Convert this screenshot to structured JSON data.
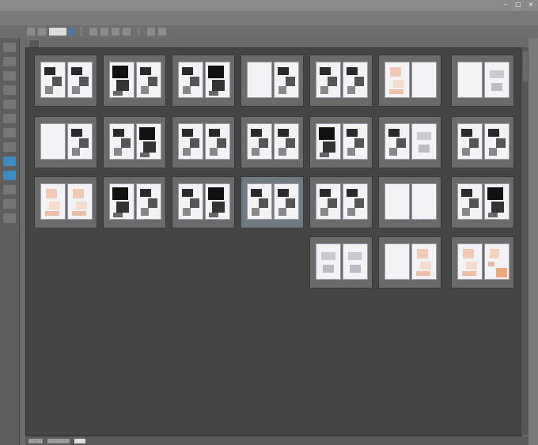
{
  "window": {
    "menu_items": [
      "",
      "",
      "",
      "",
      "",
      "",
      "",
      "",
      "",
      "",
      ""
    ],
    "controls": [
      "–",
      "□",
      "×"
    ]
  },
  "document_tab": {
    "label": ""
  },
  "spreads": [
    {
      "left": "manga",
      "right": "manga"
    },
    {
      "left": "dark",
      "right": "manga"
    },
    {
      "left": "manga",
      "right": "dark"
    },
    {
      "left": "blank",
      "right": "manga"
    },
    {
      "left": "manga",
      "right": "manga"
    },
    {
      "left": "orange",
      "right": "blank"
    },
    {
      "left": "blank",
      "right": "light"
    },
    {
      "left": "blank",
      "right": "manga"
    },
    {
      "left": "manga",
      "right": "dark"
    },
    {
      "left": "manga",
      "right": "manga"
    },
    {
      "left": "manga",
      "right": "manga"
    },
    {
      "left": "dark",
      "right": "manga"
    },
    {
      "left": "manga",
      "right": "light"
    },
    {
      "left": "manga",
      "right": "manga"
    },
    {
      "left": "orange",
      "right": "orange"
    },
    {
      "left": "dark",
      "right": "manga"
    },
    {
      "left": "manga",
      "right": "dark"
    },
    {
      "left": "manga",
      "right": "manga",
      "selected": true
    },
    {
      "left": "manga",
      "right": "manga"
    },
    {
      "left": "blank",
      "right": "blank"
    },
    {
      "left": "manga",
      "right": "dark"
    },
    {
      "left": "light",
      "right": "light"
    },
    {
      "left": "blank",
      "right": "orange"
    },
    {
      "left": "orange",
      "right": "orange2"
    }
  ]
}
